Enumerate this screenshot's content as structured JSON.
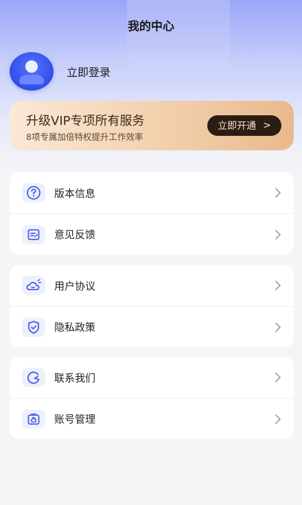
{
  "header": {
    "title": "我的中心"
  },
  "profile": {
    "login_text": "立即登录"
  },
  "vip": {
    "title": "升级VIP专项所有服务",
    "subtitle": "8项专属加倍特权提升工作效率",
    "button_label": "立即开通",
    "button_arrow": ">"
  },
  "menu": {
    "version_info": "版本信息",
    "feedback": "意见反馈",
    "user_agreement": "用户协议",
    "privacy_policy": "隐私政策",
    "contact_us": "联系我们",
    "account_management": "账号管理"
  },
  "colors": {
    "accent": "#4a5de8",
    "vip_button": "#2b1d14"
  }
}
